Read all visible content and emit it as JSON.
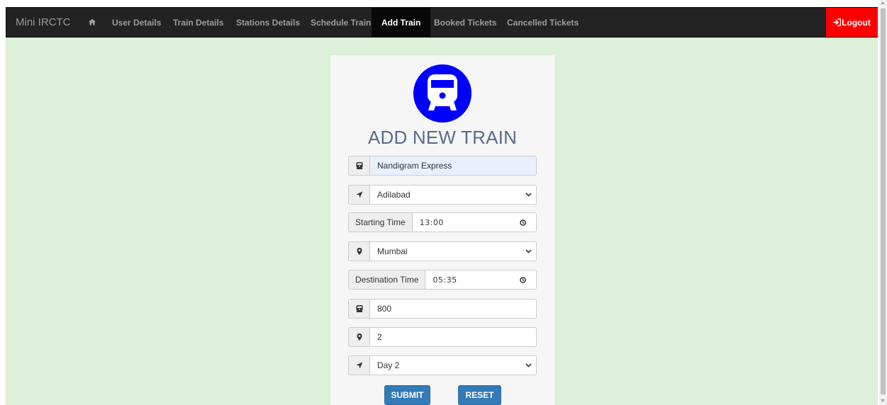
{
  "navbar": {
    "brand": "Mini IRCTC",
    "home_icon": "home-icon",
    "items": [
      {
        "label": "User Details",
        "active": false
      },
      {
        "label": "Train Details",
        "active": false
      },
      {
        "label": "Stations Details",
        "active": false
      },
      {
        "label": "Schedule Train",
        "active": false
      },
      {
        "label": "Add Train",
        "active": true
      },
      {
        "label": "Booked Tickets",
        "active": false
      },
      {
        "label": "Cancelled Tickets",
        "active": false
      }
    ],
    "logout_label": "Logout",
    "logout_icon": "log-in-icon"
  },
  "form": {
    "logo_icon": "train-icon",
    "title": "ADD NEW TRAIN",
    "train_name": {
      "value": "Nandigram Express",
      "icon": "train-icon"
    },
    "source": {
      "selected": "Adilabad",
      "icon": "send-icon"
    },
    "starting_time": {
      "label": "Starting Time",
      "value": "13:00",
      "icon": "clock-icon"
    },
    "destination": {
      "selected": "Mumbai",
      "icon": "map-marker-icon"
    },
    "destination_time": {
      "label": "Destination Time",
      "value": "05:35",
      "icon": "clock-icon"
    },
    "seats": {
      "value": "800",
      "icon": "train-icon"
    },
    "distance": {
      "value": "2",
      "icon": "map-marker-icon"
    },
    "day": {
      "selected": "Day 2",
      "icon": "send-icon"
    },
    "submit_label": "SUBMIT",
    "reset_label": "RESET"
  },
  "colors": {
    "background": "#ddf0d9",
    "navbar": "#222222",
    "logout": "#ff0000",
    "logo": "#0000ff",
    "button": "#337ab7",
    "title": "#5a6a8e"
  }
}
